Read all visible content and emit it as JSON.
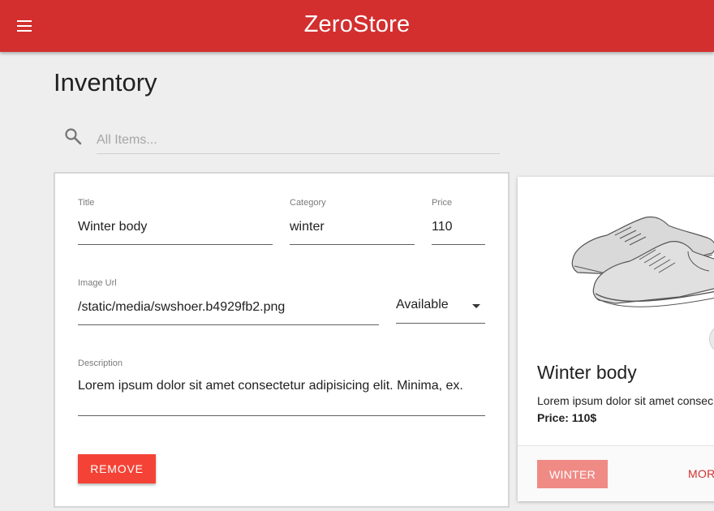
{
  "app": {
    "title": "ZeroStore",
    "menu_icon": "menu-icon",
    "brand_color": "#d32f2f"
  },
  "page": {
    "title": "Inventory"
  },
  "search": {
    "icon": "search-icon",
    "placeholder": "All Items..."
  },
  "edit_form": {
    "title_label": "Title",
    "title_value": "Winter body",
    "category_label": "Category",
    "category_value": "winter",
    "price_label": "Price",
    "price_value": "110",
    "image_url_label": "Image Url",
    "image_url_value": "/static/media/swshoer.b4929fb2.png",
    "availability_value": "Available",
    "description_label": "Description",
    "description_value": "Lorem ipsum dolor sit amet consectetur adipisicing elit. Minima, ex.",
    "remove_label": "REMOVE",
    "remove_color": "#f44336"
  },
  "product_card": {
    "image_icon": "sneakers-image",
    "title": "Winter body",
    "description": "Lorem ipsum dolor sit amet consec",
    "price": "Price: 110$",
    "tag_label": "WINTER",
    "more_label": "MOR"
  }
}
